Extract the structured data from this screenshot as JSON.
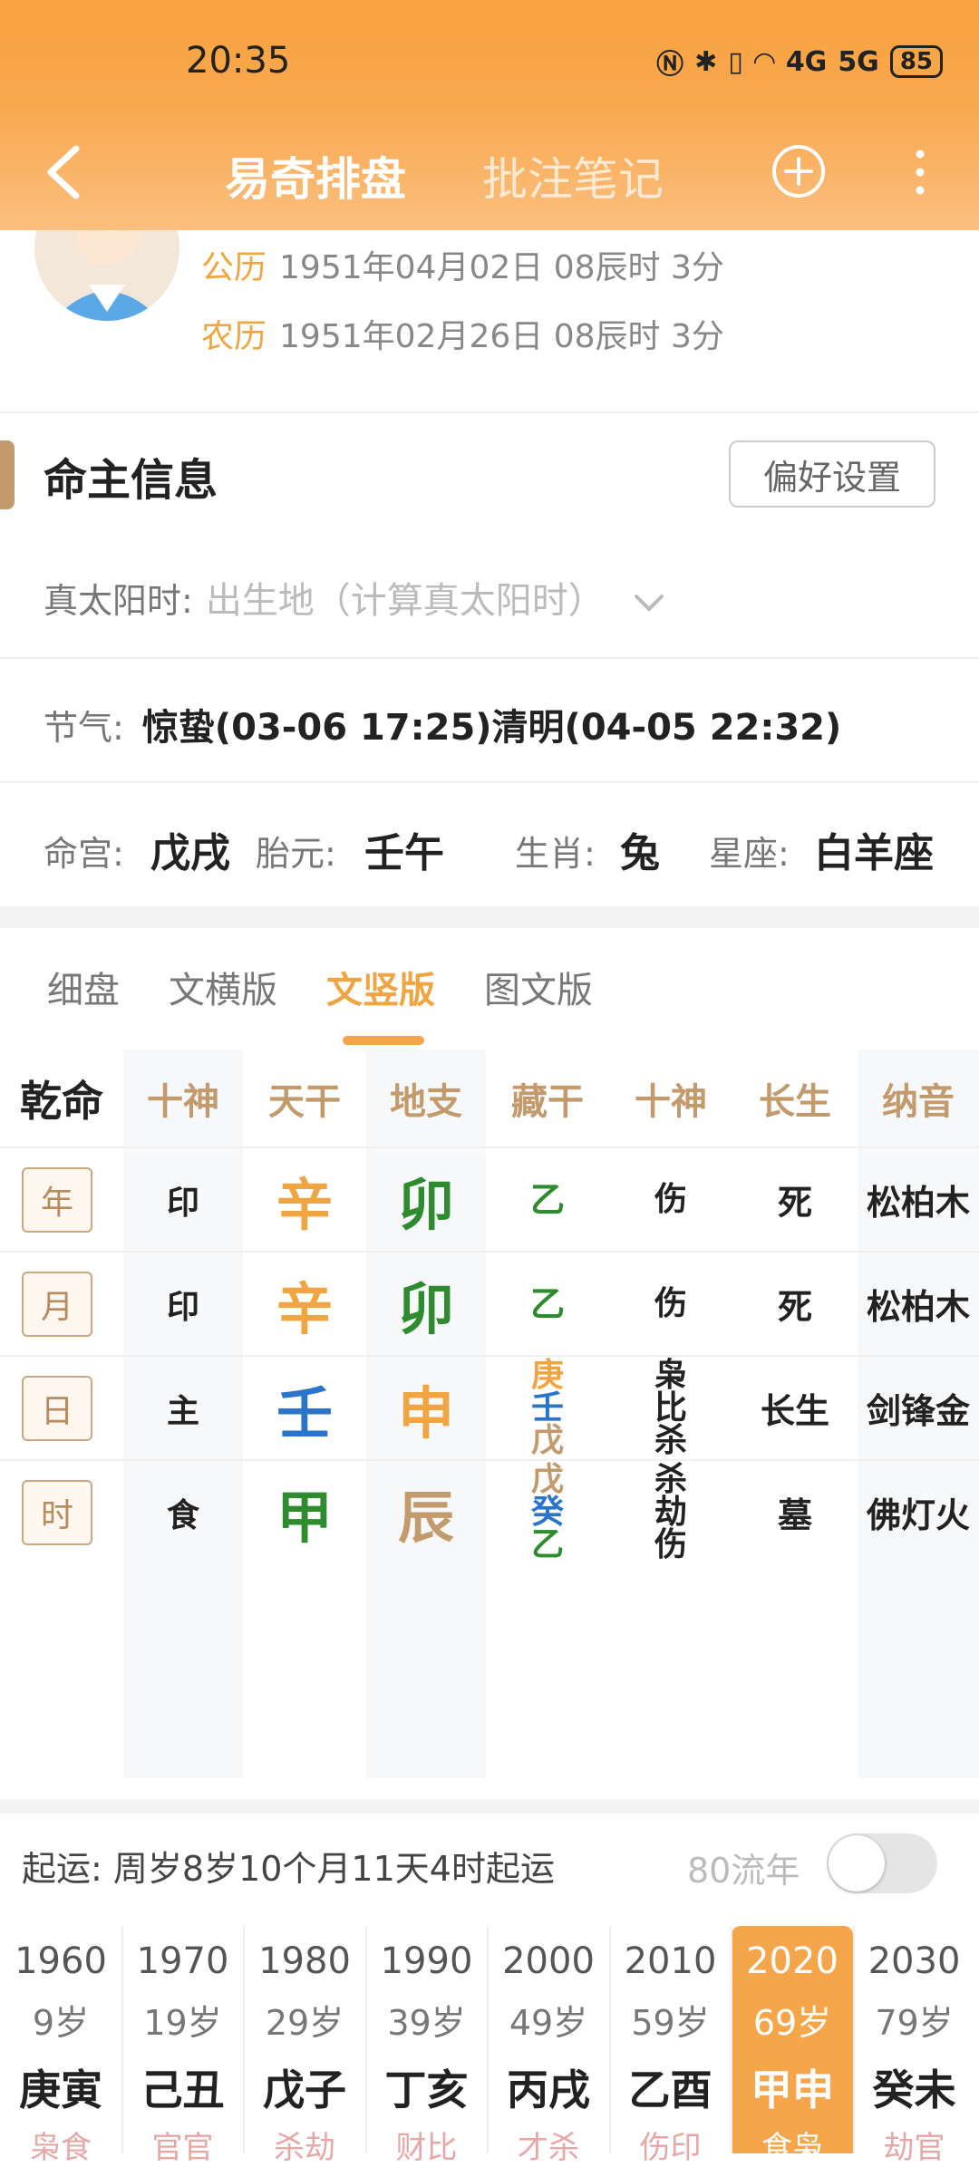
{
  "status": {
    "time": "20:35",
    "battery": "85",
    "signal1": "4G",
    "signal2": "5G"
  },
  "nav": {
    "tab_active": "易奇排盘",
    "tab_inactive": "批注笔记"
  },
  "profile": {
    "solar_label": "公历",
    "solar_value": "1951年04月02日 08辰时 3分",
    "lunar_label": "农历",
    "lunar_value": "1951年02月26日 08辰时 3分"
  },
  "section": {
    "title": "命主信息",
    "pref_button": "偏好设置"
  },
  "solar_time": {
    "label": "真太阳时:",
    "placeholder": "出生地（计算真太阳时）"
  },
  "jieqi": {
    "label": "节气:",
    "value": "惊蛰(03-06 17:25)清明(04-05 22:32)"
  },
  "info": {
    "minggong_label": "命宫:",
    "minggong": "戊戌",
    "taiyuan_label": "胎元:",
    "taiyuan": "壬午",
    "shengxiao_label": "生肖:",
    "shengxiao": "兔",
    "xingzuo_label": "星座:",
    "xingzuo": "白羊座"
  },
  "tabs": [
    "细盘",
    "文横版",
    "文竖版",
    "图文版"
  ],
  "chart_headers": [
    "乾命",
    "十神",
    "天干",
    "地支",
    "藏干",
    "十神",
    "长生",
    "纳音"
  ],
  "pillars": [
    {
      "label": "年",
      "shishen": "印",
      "tiangan": "辛",
      "dizhi": "卯",
      "canggan": [
        "乙"
      ],
      "cang_shishen": [
        "伤"
      ],
      "changsheng": "死",
      "nayin": "松柏木"
    },
    {
      "label": "月",
      "shishen": "印",
      "tiangan": "辛",
      "dizhi": "卯",
      "canggan": [
        "乙"
      ],
      "cang_shishen": [
        "伤"
      ],
      "changsheng": "死",
      "nayin": "松柏木"
    },
    {
      "label": "日",
      "shishen": "主",
      "tiangan": "壬",
      "dizhi": "申",
      "canggan": [
        "庚",
        "壬",
        "戊"
      ],
      "cang_shishen": [
        "枭",
        "比",
        "杀"
      ],
      "changsheng": "长生",
      "nayin": "剑锋金"
    },
    {
      "label": "时",
      "shishen": "食",
      "tiangan": "甲",
      "dizhi": "辰",
      "canggan": [
        "戊",
        "癸",
        "乙"
      ],
      "cang_shishen": [
        "杀",
        "劫",
        "伤"
      ],
      "changsheng": "墓",
      "nayin": "佛灯火"
    }
  ],
  "colors": {
    "metal": "#f0a541",
    "water": "#2a74c9",
    "wood": "#2e8b2e",
    "earth": "#c29a6c",
    "accent": "#f5a54a"
  },
  "qiyun": {
    "text": "起运: 周岁8岁10个月11天4时起运",
    "liunian_label": "80流年",
    "toggle_on": false
  },
  "dayun": [
    {
      "year": "1960",
      "age": "9岁",
      "gz": "庚寅",
      "sub": "枭食"
    },
    {
      "year": "1970",
      "age": "19岁",
      "gz": "己丑",
      "sub": "官官"
    },
    {
      "year": "1980",
      "age": "29岁",
      "gz": "戊子",
      "sub": "杀劫"
    },
    {
      "year": "1990",
      "age": "39岁",
      "gz": "丁亥",
      "sub": "财比"
    },
    {
      "year": "2000",
      "age": "49岁",
      "gz": "丙戌",
      "sub": "才杀"
    },
    {
      "year": "2010",
      "age": "59岁",
      "gz": "乙酉",
      "sub": "伤印"
    },
    {
      "year": "2020",
      "age": "69岁",
      "gz": "甲申",
      "sub": "食枭",
      "active": true
    },
    {
      "year": "2030",
      "age": "79岁",
      "gz": "癸未",
      "sub": "劫官"
    }
  ]
}
